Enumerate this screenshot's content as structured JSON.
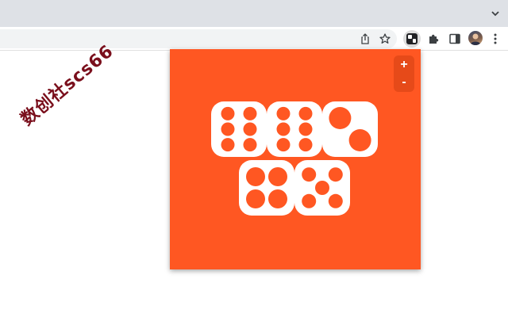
{
  "browser": {
    "tabstrip_color": "#dee1e6",
    "toolbar_icons": [
      "share-icon",
      "bookmark-star-icon",
      "dice-extension-icon",
      "extensions-puzzle-icon",
      "side-panel-icon",
      "profile-avatar",
      "more-menu-icon"
    ]
  },
  "watermark": {
    "text": "数创社scs66"
  },
  "popup": {
    "background": "#ff5722",
    "zoom_in_label": "+",
    "zoom_out_label": "-",
    "dice_values": [
      6,
      6,
      2,
      4,
      5
    ]
  }
}
